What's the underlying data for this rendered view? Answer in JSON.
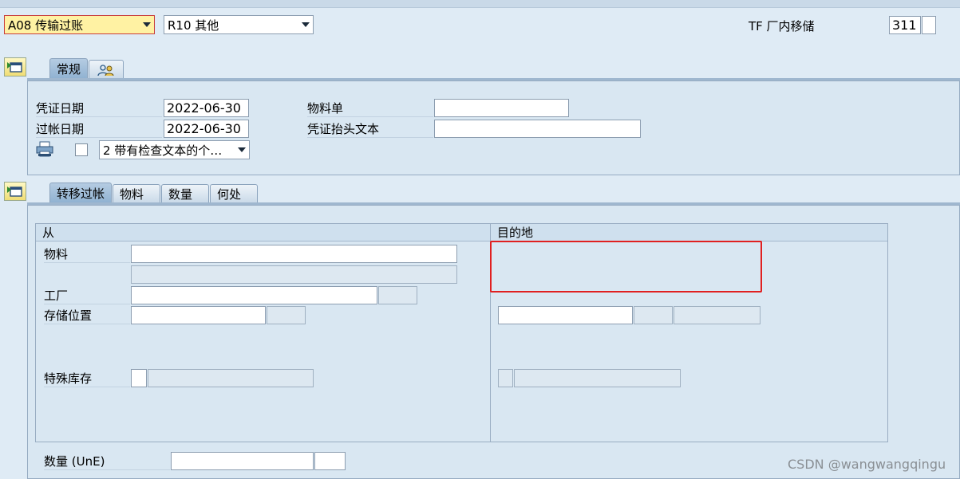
{
  "top": {
    "action_select": "A08 传输过账",
    "reference_select": "R10 其他",
    "movement_type_label": "TF 厂内移储",
    "movement_type_value": "311",
    "movement_type_extra": ""
  },
  "header_tabs": [
    {
      "label": "常规",
      "active": true
    },
    {
      "label": "",
      "icon": "people-icon",
      "active": false
    }
  ],
  "general": {
    "doc_date_label": "凭证日期",
    "doc_date_value": "2022-06-30",
    "post_date_label": "过帐日期",
    "post_date_value": "2022-06-30",
    "material_slip_label": "物料单",
    "material_slip_value": "",
    "header_text_label": "凭证抬头文本",
    "header_text_value": "",
    "print_version_select": "2 带有检查文本的个…"
  },
  "item_tabs": [
    {
      "label": "转移过帐",
      "active": true
    },
    {
      "label": "物料",
      "active": false
    },
    {
      "label": "数量",
      "active": false
    },
    {
      "label": "何处",
      "active": false
    }
  ],
  "transfer": {
    "from_header": "从",
    "to_header": "目的地",
    "material_label": "物料",
    "plant_label": "工厂",
    "storage_label": "存储位置",
    "special_stock_label": "特殊库存",
    "qty_label": "数量 (UnE)"
  },
  "watermark": "CSDN @wangwangqingu",
  "colors": {
    "background": "#dfebf5",
    "highlight_box": "#e02020",
    "required_field": "#fff2a3"
  }
}
